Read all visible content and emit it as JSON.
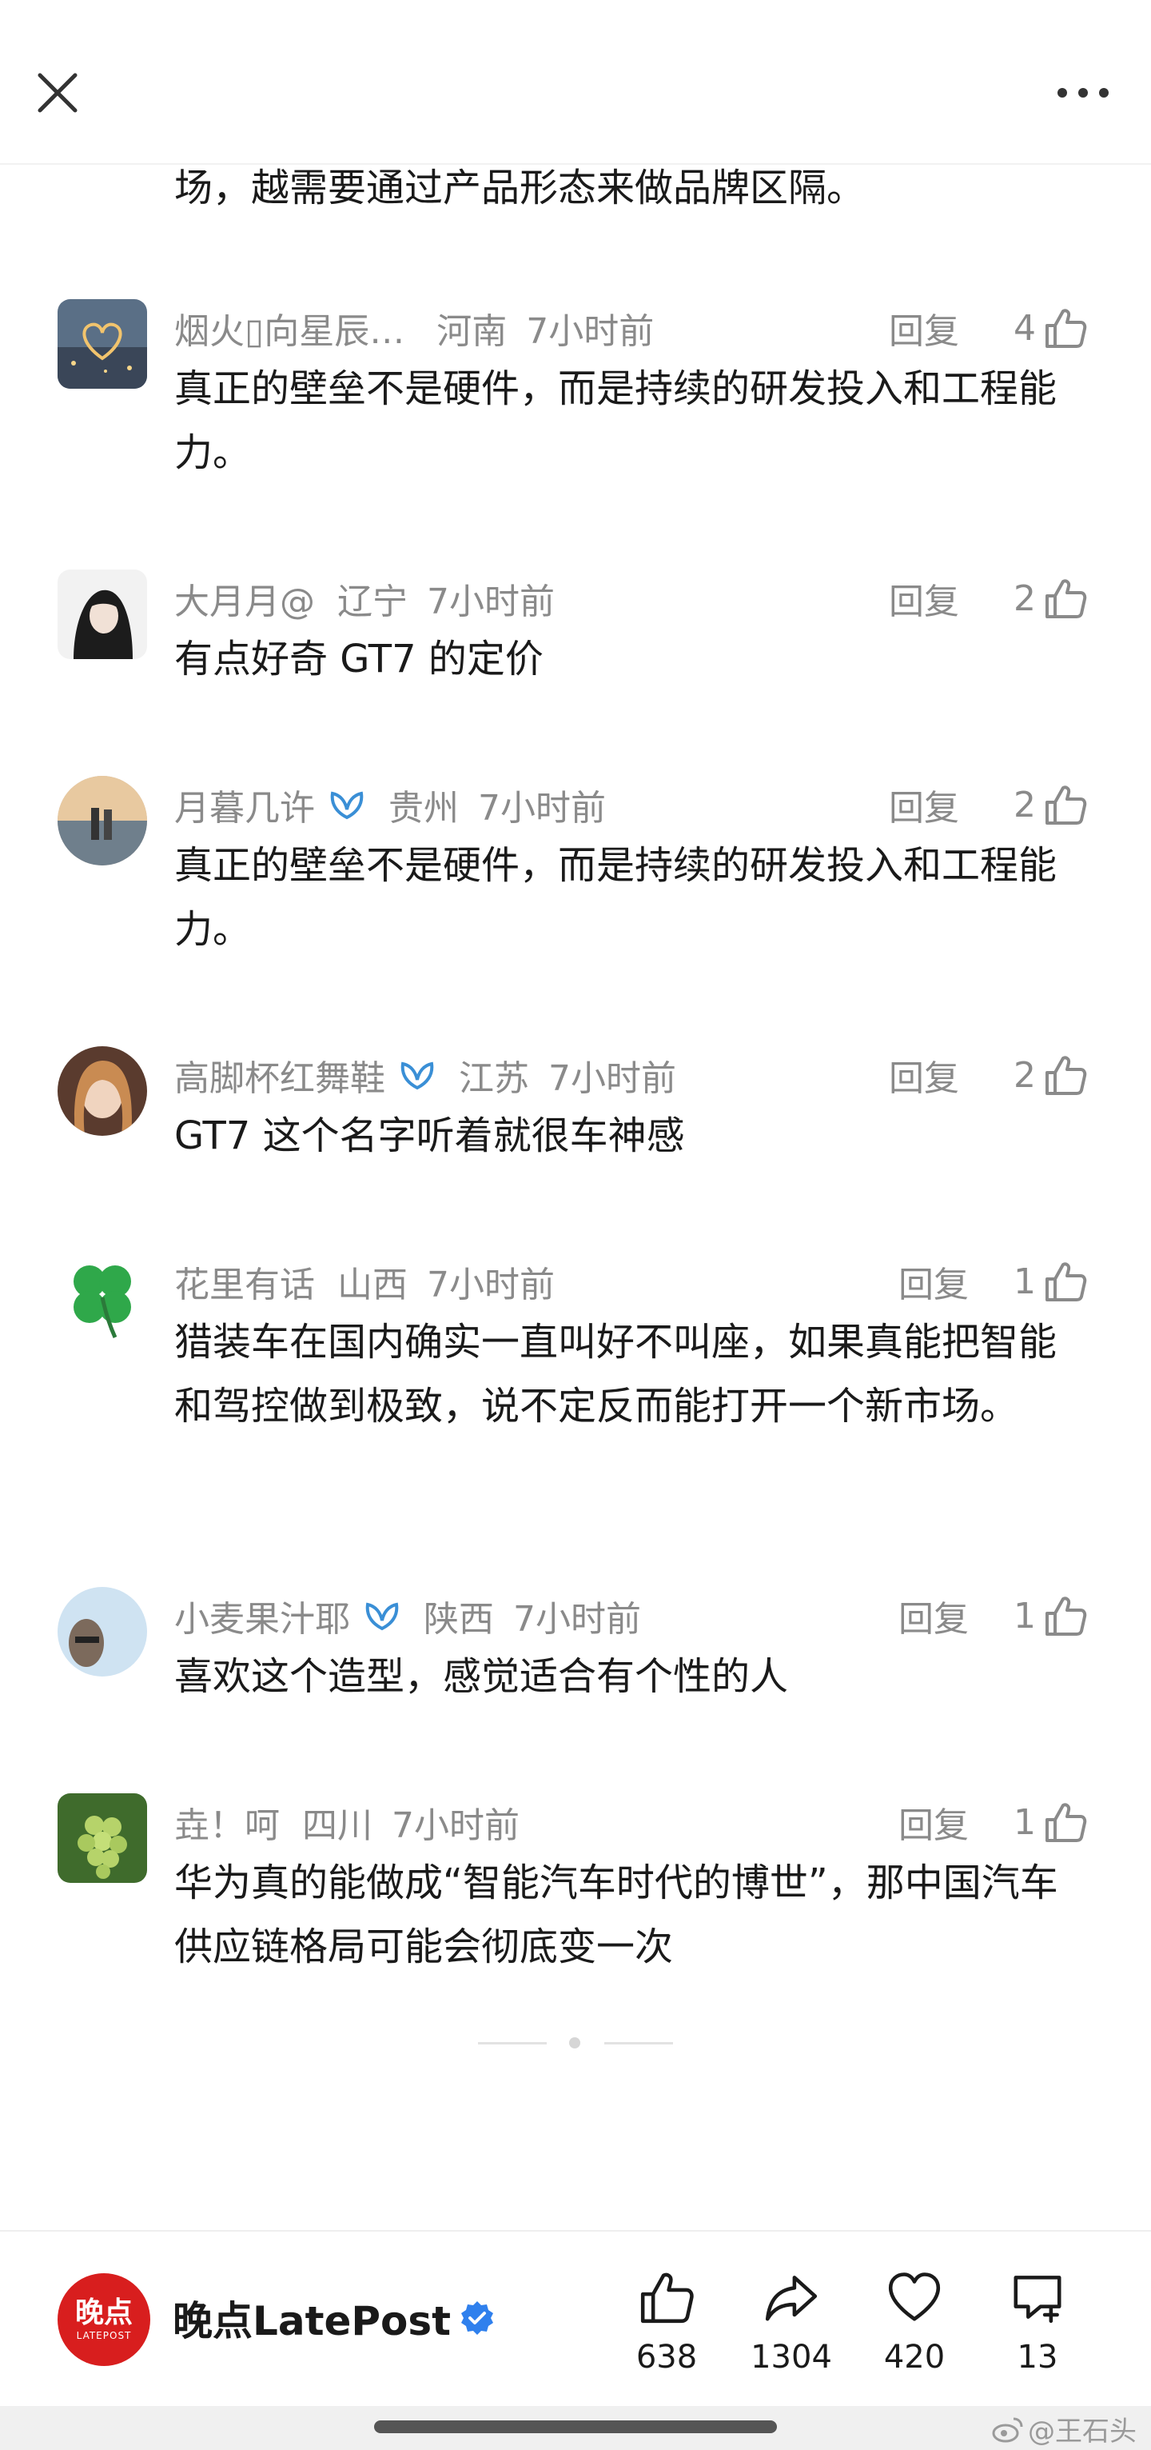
{
  "partial_text": "场，越需要通过产品形态来做品牌区隔。",
  "reply_label": "回复",
  "comments": [
    {
      "username": "烟火▯向星辰…",
      "location": "河南",
      "time": "7小时前",
      "likes": "4",
      "text": "真正的壁垒不是硬件，而是持续的研发投入和工程能力。",
      "verified": false
    },
    {
      "username": "大月月@",
      "location": "辽宁",
      "time": "7小时前",
      "likes": "2",
      "text": "有点好奇 GT7 的定价",
      "verified": false
    },
    {
      "username": "月暮几许",
      "location": "贵州",
      "time": "7小时前",
      "likes": "2",
      "text": "真正的壁垒不是硬件，而是持续的研发投入和工程能力。",
      "verified": true
    },
    {
      "username": "高脚杯红舞鞋",
      "location": "江苏",
      "time": "7小时前",
      "likes": "2",
      "text": "GT7 这个名字听着就很车神感",
      "verified": true
    },
    {
      "username": "花里有话",
      "location": "山西",
      "time": "7小时前",
      "likes": "1",
      "text": "猎装车在国内确实一直叫好不叫座，如果真能把智能和驾控做到极致，说不定反而能打开一个新市场。",
      "verified": false
    },
    {
      "username": "小麦果汁耶",
      "location": "陕西",
      "time": "7小时前",
      "likes": "1",
      "text": "喜欢这个造型，感觉适合有个性的人",
      "verified": true
    },
    {
      "username": "垚！呵",
      "location": "四川",
      "time": "7小时前",
      "likes": "1",
      "text": "华为真的能做成“智能汽车时代的博世”，那中国汽车供应链格局可能会彻底变一次",
      "verified": false
    }
  ],
  "bottom_bar": {
    "brand_logo_text": "晚点",
    "brand_logo_sub": "LATEPOST",
    "brand_name": "晚点LatePost",
    "like_count": "638",
    "share_count": "1304",
    "favorite_count": "420",
    "comment_count": "13"
  },
  "watermark": "@王石头",
  "colors": {
    "accent_blue": "#3a8fd6",
    "brand_red": "#d81e1e",
    "meta_gray": "#8a8a8a"
  }
}
